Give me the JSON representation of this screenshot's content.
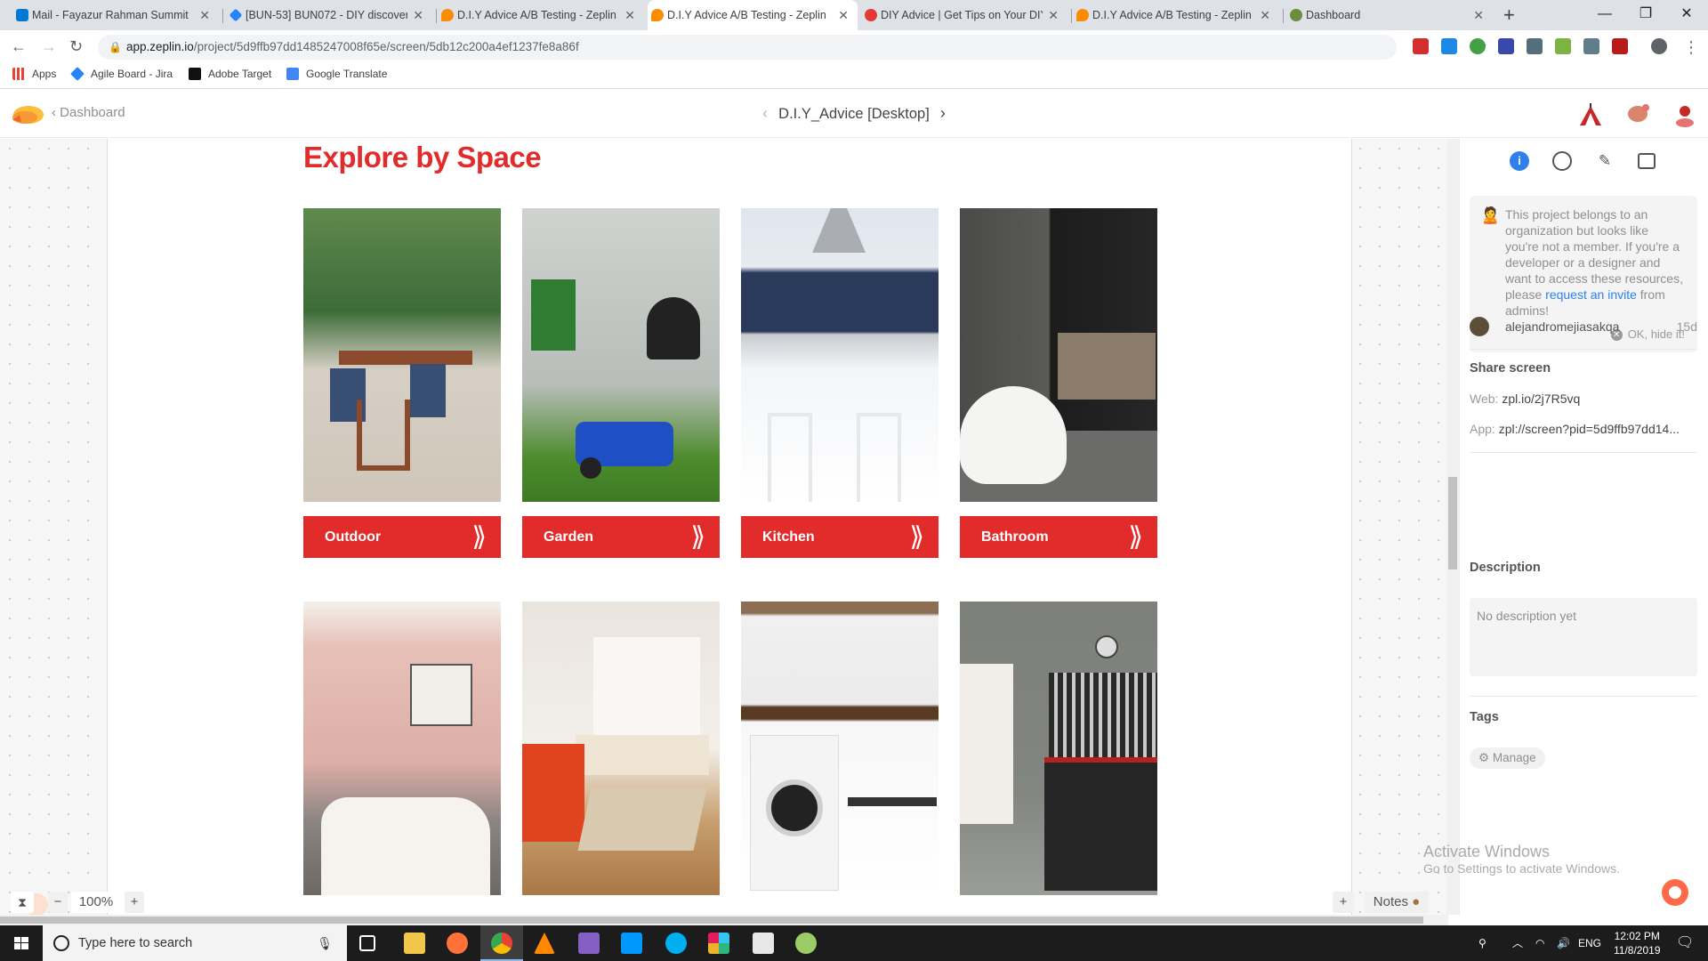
{
  "browser": {
    "tabs": [
      {
        "title": "Mail - Fayazur Rahman Summit",
        "color": "#0078d4"
      },
      {
        "title": "[BUN-53] BUN072 - DIY discover",
        "color": "#2684ff"
      },
      {
        "title": "D.I.Y Advice A/B Testing - Zeplin",
        "color": "#fb8c00"
      },
      {
        "title": "D.I.Y Advice A/B Testing - Zeplin",
        "color": "#fb8c00"
      },
      {
        "title": "DIY Advice | Get Tips on Your DIY",
        "color": "#e53935"
      },
      {
        "title": "D.I.Y Advice A/B Testing - Zeplin",
        "color": "#fb8c00"
      },
      {
        "title": "Dashboard",
        "color": "#6d8c3e"
      }
    ],
    "url_host": "app.zeplin.io",
    "url_path": "/project/5d9ffb97dd1485247008f65e/screen/5db12c200a4ef1237fe8a86f",
    "bookmarks": [
      "Apps",
      "Agile Board - Jira",
      "Adobe Target",
      "Google Translate"
    ]
  },
  "zeplin": {
    "back_label": "Dashboard",
    "screen_name": "D.I.Y_Advice [Desktop]",
    "zoom": "100%",
    "notes_label": "Notes"
  },
  "artboard": {
    "heading": "Explore by Space",
    "categories": [
      "Outdoor",
      "Garden",
      "Kitchen",
      "Bathroom"
    ],
    "chevron": "⟫",
    "accent": "#e22c2c"
  },
  "panel": {
    "notice_text": "This project belongs to an organization but looks like you're not a member. If you're a developer or a designer and want to access these resources, please",
    "notice_link": "request an invite",
    "notice_tail": "from admins!",
    "hide_label": "OK, hide it!",
    "user": "alejandromejiasakqa",
    "user_time": "15d",
    "share_title": "Share screen",
    "web_label": "Web:",
    "web_value": "zpl.io/2j7R5vq",
    "app_label": "App:",
    "app_value": "zpl://screen?pid=5d9ffb97dd14...",
    "description_title": "Description",
    "description_placeholder": "No description yet",
    "tags_title": "Tags",
    "manage_label": "Manage"
  },
  "windows": {
    "activate_title": "Activate Windows",
    "activate_sub": "Go to Settings to activate Windows.",
    "search_placeholder": "Type here to search",
    "lang": "ENG",
    "time": "12:02 PM",
    "date": "11/8/2019"
  }
}
